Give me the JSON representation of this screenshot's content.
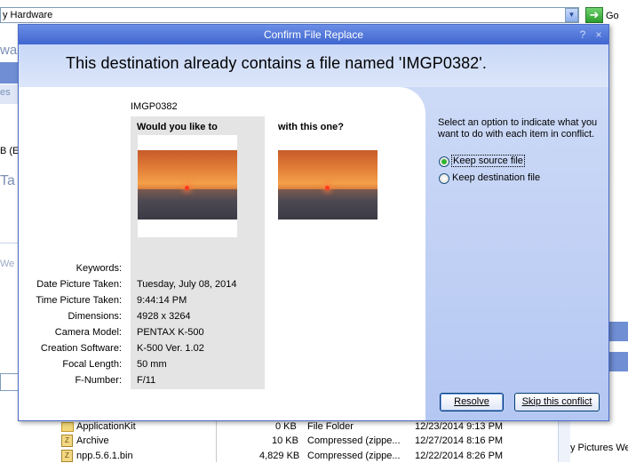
{
  "background": {
    "address_text": "y Hardware",
    "go_label": "Go",
    "left_labels": [
      "wa",
      "es",
      "B (E",
      "Ta",
      "We"
    ],
    "right_label": "y Pictures We",
    "files": [
      {
        "name": "ApplicationKit",
        "size": "0 KB",
        "type": "File Folder",
        "date": "12/23/2014 9:13 PM"
      },
      {
        "name": "Archive",
        "size": "10 KB",
        "type": "Compressed (zippe...",
        "date": "12/27/2014 8:16 PM"
      },
      {
        "name": "npp.5.6.1.bin",
        "size": "4,829 KB",
        "type": "Compressed (zippe...",
        "date": "12/22/2014 8:26 PM"
      }
    ]
  },
  "dialog": {
    "title": "Confirm File Replace",
    "help_symbol": "?",
    "close_symbol": "×",
    "header_message": "This destination already contains a file named 'IMGP0382'.",
    "file_name": "IMGP0382",
    "source_heading": "Would you like to",
    "dest_heading": "with this one?",
    "properties": [
      {
        "label": "Keywords:",
        "value": ""
      },
      {
        "label": "Date Picture Taken:",
        "value": "Tuesday, July 08, 2014"
      },
      {
        "label": "Time Picture Taken:",
        "value": "9:44:14 PM"
      },
      {
        "label": "Dimensions:",
        "value": "4928 x 3264"
      },
      {
        "label": "Camera Model:",
        "value": "PENTAX K-500"
      },
      {
        "label": "Creation Software:",
        "value": "K-500 Ver. 1.02"
      },
      {
        "label": "Focal Length:",
        "value": "50 mm"
      },
      {
        "label": "F-Number:",
        "value": "F/11"
      }
    ],
    "instruction": "Select an option to indicate what you want to do with each item in conflict.",
    "options": [
      {
        "label": "Keep source file",
        "selected": true
      },
      {
        "label": "Keep destination file",
        "selected": false
      }
    ],
    "resolve_label": "Resolve",
    "skip_label": "Skip this conflict"
  }
}
